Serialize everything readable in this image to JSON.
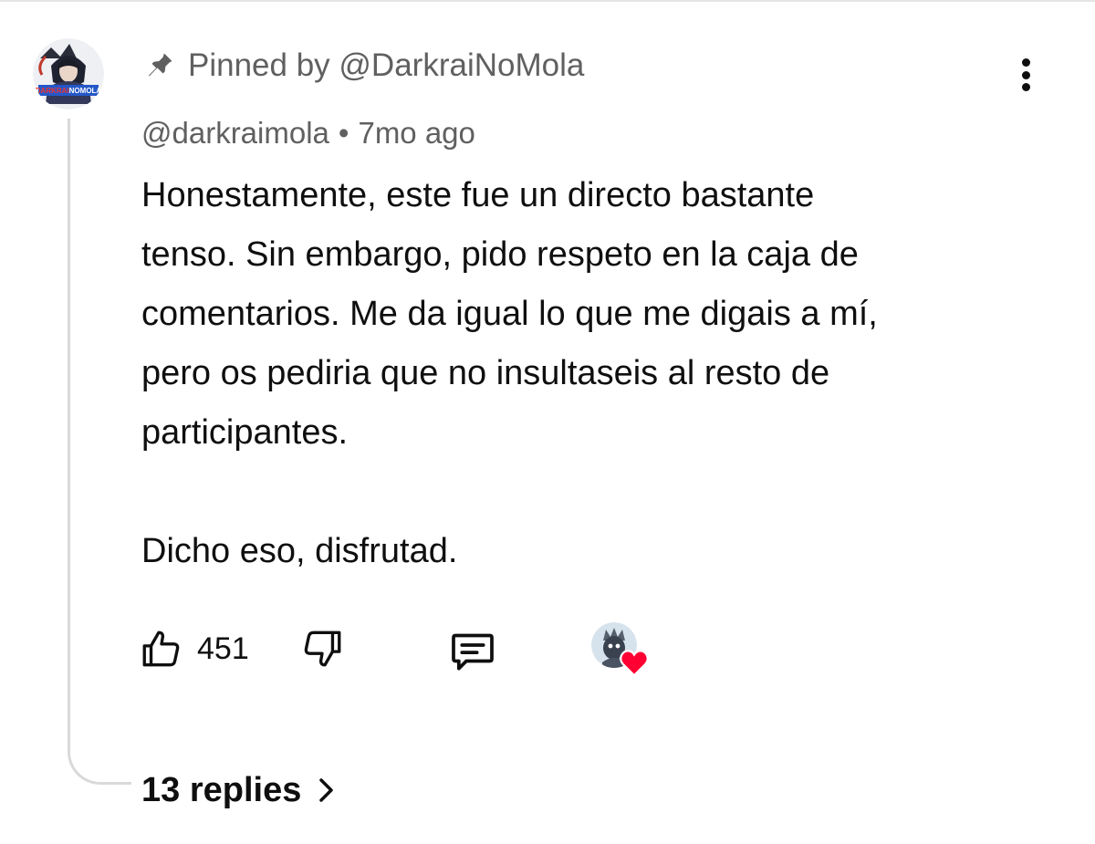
{
  "comment": {
    "pinned_label": "Pinned by @DarkraiNoMola",
    "author_handle": "@darkraimola",
    "separator": "•",
    "timestamp": "7mo ago",
    "avatar_text": "DARKRAINOMOLA",
    "body": {
      "paragraph_1_lines": [
        "Honestamente, este fue un directo bastante",
        "tenso. Sin embargo, pido respeto en la caja de",
        "comentarios. Me da igual lo que me digais a mí,",
        "pero os pediria que no insultaseis al resto de",
        "participantes."
      ],
      "paragraph_2": "Dicho eso, disfrutad."
    },
    "actions": {
      "like_count": "451",
      "like_icon": "thumbs-up-icon",
      "dislike_icon": "thumbs-down-icon",
      "reply_icon": "comment-icon",
      "creator_heart_icon": "heart-icon"
    },
    "replies_label": "13 replies"
  },
  "colors": {
    "text_primary": "#0f0f0f",
    "text_secondary": "#606060",
    "thread_line": "#d9d9d9",
    "heart": "#ff0033"
  }
}
